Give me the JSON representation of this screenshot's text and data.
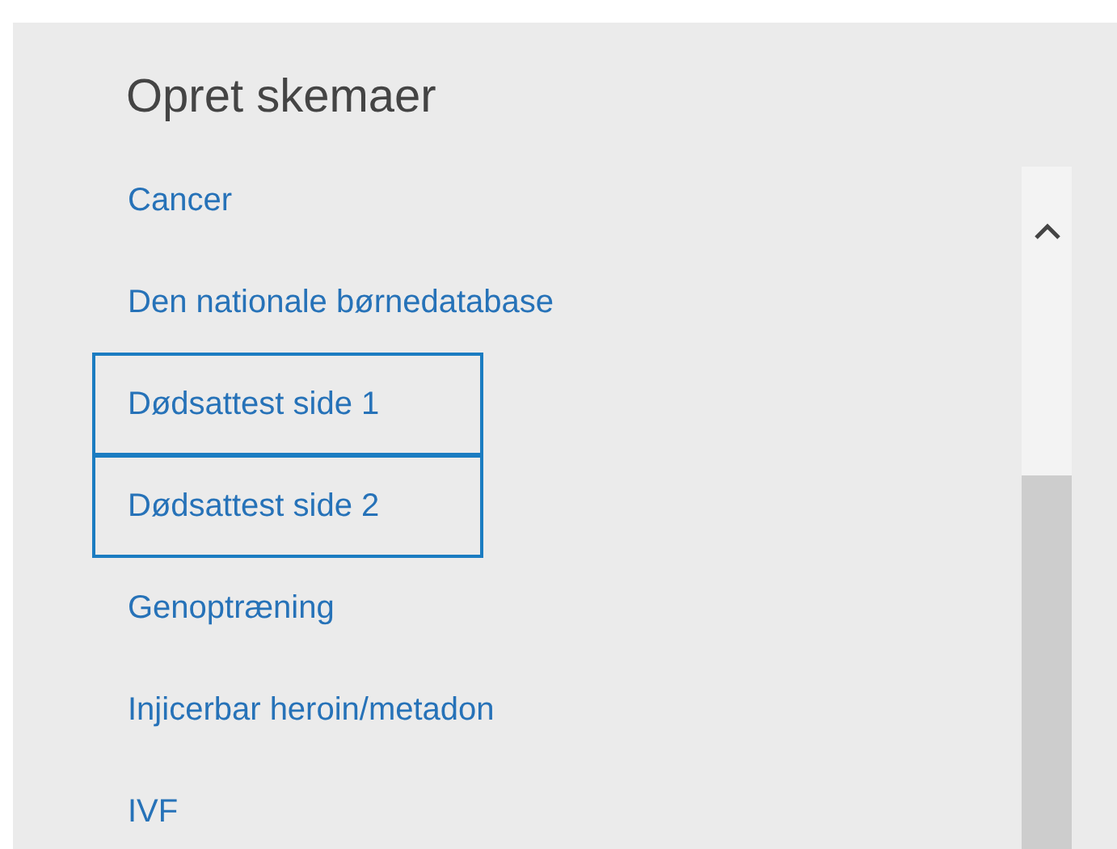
{
  "panel": {
    "title": "Opret skemaer"
  },
  "items": [
    {
      "label": "Cancer",
      "highlighted": false
    },
    {
      "label": "Den nationale børnedatabase",
      "highlighted": false
    },
    {
      "label": "Dødsattest side 1",
      "highlighted": true
    },
    {
      "label": "Dødsattest side 2",
      "highlighted": true
    },
    {
      "label": "Genoptræning",
      "highlighted": false
    },
    {
      "label": "Injicerbar heroin/metadon",
      "highlighted": false
    },
    {
      "label": "IVF",
      "highlighted": false
    }
  ]
}
